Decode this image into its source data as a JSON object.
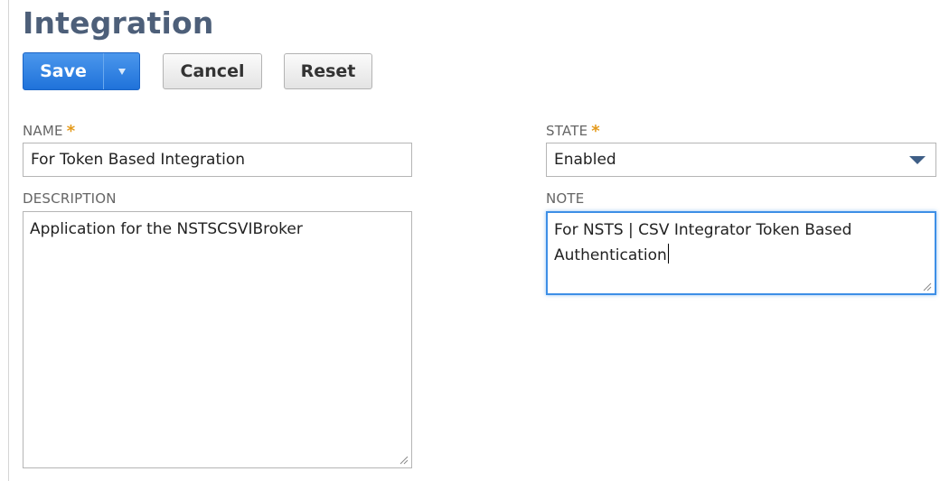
{
  "page": {
    "title": "Integration"
  },
  "toolbar": {
    "save_label": "Save",
    "save_menu_icon": "dropdown-triangle-icon",
    "cancel_label": "Cancel",
    "reset_label": "Reset"
  },
  "form": {
    "name": {
      "label": "NAME",
      "required_mark": "*",
      "value": "For Token Based Integration"
    },
    "state": {
      "label": "STATE",
      "required_mark": "*",
      "value": "Enabled"
    },
    "description": {
      "label": "DESCRIPTION",
      "value": "Application for the NSTSCSVIBroker"
    },
    "note": {
      "label": "NOTE",
      "value": "For NSTS | CSV Integrator Token Based Authentication"
    }
  },
  "colors": {
    "title": "#4d5f79",
    "primary_button": "#2a7de1",
    "required_mark": "#e49a1b",
    "focus_border": "#3d8fe6"
  }
}
